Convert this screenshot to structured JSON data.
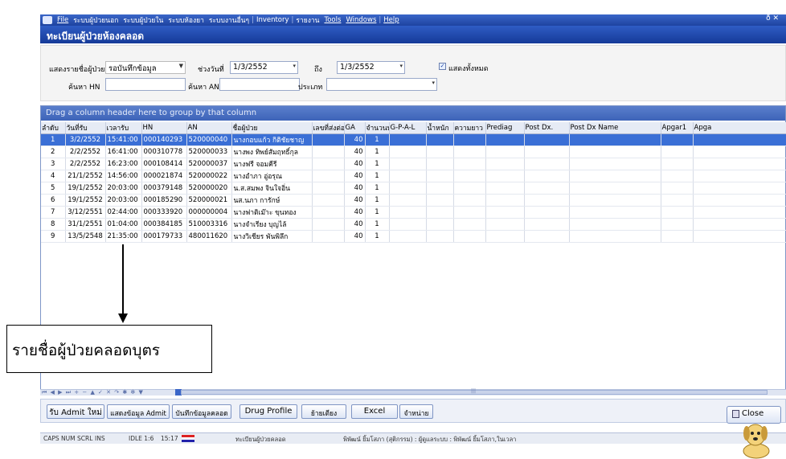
{
  "menubar": {
    "items": [
      "File",
      "ระบบผู้ป่วยนอก",
      "ระบบผู้ป่วยใน",
      "ระบบห้องยา",
      "ระบบงานอื่นๆ",
      "Inventory",
      "รายงาน",
      "Tools",
      "Windows",
      "Help"
    ],
    "window_controls": "ð ✕"
  },
  "header": {
    "title": "ทะเบียนผู้ป่วยห้องคลอด"
  },
  "filter": {
    "show_label": "แสดงรายชื่อผู้ป่วย",
    "show_value": "รอบันทึกข้อมูล",
    "date_label": "ช่วงวันที่",
    "date_from": "1/3/2552",
    "to_label": "ถึง",
    "date_to": "1/3/2552",
    "showall_label": "แสดงทั้งหมด",
    "hn_label": "ค้นหา HN",
    "an_label": "ค้นหา AN",
    "type_label": "ประเภท"
  },
  "grid": {
    "group_hint": "Drag a column header here to group by that column",
    "columns": [
      "ลำดับ",
      "วันที่รับ",
      "เวลารับ",
      "HN",
      "AN",
      "ชื่อผู้ป่วย",
      "เลขที่ส่งต่อ",
      "GA",
      "จำนวนบุตร",
      "G-P-A-L",
      "น้ำหนัก",
      "ความยาว",
      "Prediag",
      "Post Dx.",
      "Post Dx Name",
      "Apgar1",
      "Apga"
    ],
    "rows": [
      [
        "1",
        "3/2/2552",
        "15:41:00",
        "000140293",
        "520000040",
        "นางกอบแก้ว กิติชัยชาญ",
        "",
        "40",
        "1"
      ],
      [
        "2",
        "2/2/2552",
        "16:41:00",
        "000310778",
        "520000033",
        "นางพง ทิพย์สัมฤทธิ์กุล",
        "",
        "40",
        "1"
      ],
      [
        "3",
        "2/2/2552",
        "16:23:00",
        "000108414",
        "520000037",
        "นางฟรี จอมคีรี",
        "",
        "40",
        "1"
      ],
      [
        "4",
        "21/1/2552",
        "14:56:00",
        "000021874",
        "520000022",
        "นางอำภา อู่อรุณ",
        "",
        "40",
        "1"
      ],
      [
        "5",
        "19/1/2552",
        "20:03:00",
        "000379148",
        "520000020",
        "น.ส.สมพง จินใจอิ่น",
        "",
        "40",
        "1"
      ],
      [
        "6",
        "19/1/2552",
        "20:03:00",
        "000185290",
        "520000021",
        "นส.นภา การักษ์",
        "",
        "40",
        "1"
      ],
      [
        "7",
        "3/12/2551",
        "02:44:00",
        "000333920",
        "000000004",
        "นางฟาติเม๊าะ ขุนทอง",
        "",
        "40",
        "1"
      ],
      [
        "8",
        "31/1/2551",
        "01:04:00",
        "000384185",
        "510003316",
        "นางจำเรียง บุญไล้",
        "",
        "40",
        "1"
      ],
      [
        "9",
        "13/5/2548",
        "21:35:00",
        "000179733",
        "480011620",
        "นางวิเชียร พันพิลึก",
        "",
        "40",
        "1"
      ]
    ],
    "nav_symbols": "⏮ ◀ ▶ ⏭ + − ▲ ✓ ✕ ↷ ✱ ✻ ▼",
    "scroll_mark": "|||"
  },
  "buttons": {
    "admit_new": "รับ Admit ใหม่",
    "show_admit": "แสดงข้อมูล Admit",
    "save_birth": "บันทึกข้อมูลคลอด",
    "drug_profile": "Drug Profile",
    "move_bed": "ย้ายเตียง",
    "excel": "Excel",
    "discharge": "จำหน่าย",
    "close": "Close"
  },
  "status": {
    "caps": "CAPS",
    "num": "NUM",
    "scrl": "SCRL",
    "ins": "INS",
    "idle": "IDLE 1:6",
    "time": "15:17",
    "form": "ทะเบียนผู้ป่วยคลอด",
    "user": "พิพัฒน์ ยิ้มโสภา (สุติกรรม) : ผู้ดูแลระบบ : พิพัฒน์ ยิ้มโสภา,ในเวลา"
  },
  "annotation": {
    "text": "รายชื่อผู้ป่วยคลอดบุตร"
  },
  "colors": {
    "accent": "#2f5cc4",
    "selected_row": "#3a6fd6"
  }
}
